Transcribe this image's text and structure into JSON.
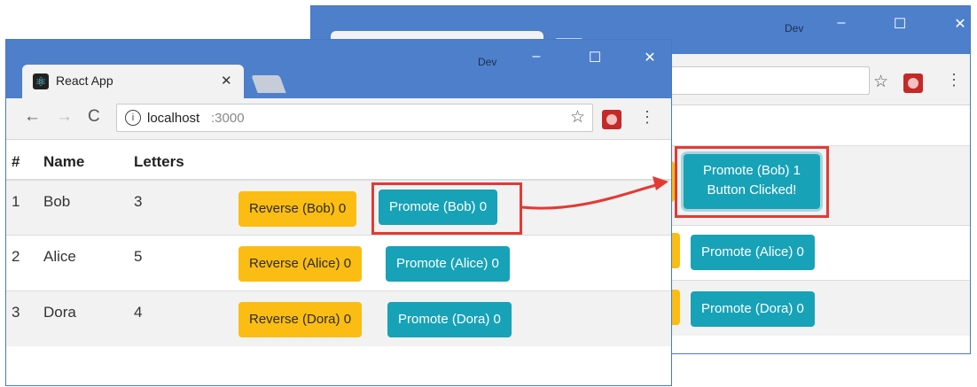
{
  "back_window": {
    "profile_label": "Dev",
    "rows": [
      {
        "promote_label": "Promote (Bob) 1",
        "clicked_label": "Button Clicked!"
      },
      {
        "promote_label": "Promote (Alice) 0"
      },
      {
        "promote_label": "Promote (Dora) 0"
      }
    ]
  },
  "front_window": {
    "profile_label": "Dev",
    "tab_title": "React App",
    "address": {
      "host": "localhost",
      "port": ":3000"
    },
    "table": {
      "headers": {
        "index": "#",
        "name": "Name",
        "letters": "Letters"
      },
      "rows": [
        {
          "index": "1",
          "name": "Bob",
          "letters": "3",
          "reverse_label": "Reverse (Bob) 0",
          "promote_label": "Promote (Bob) 0"
        },
        {
          "index": "2",
          "name": "Alice",
          "letters": "5",
          "reverse_label": "Reverse (Alice) 0",
          "promote_label": "Promote (Alice) 0"
        },
        {
          "index": "3",
          "name": "Dora",
          "letters": "4",
          "reverse_label": "Reverse (Dora) 0",
          "promote_label": "Promote (Dora) 0"
        }
      ]
    }
  },
  "colors": {
    "titlebar": "#4d7fcb",
    "teal": "#17a2b8",
    "yellow": "#fbbd13",
    "highlight": "#e53935"
  }
}
